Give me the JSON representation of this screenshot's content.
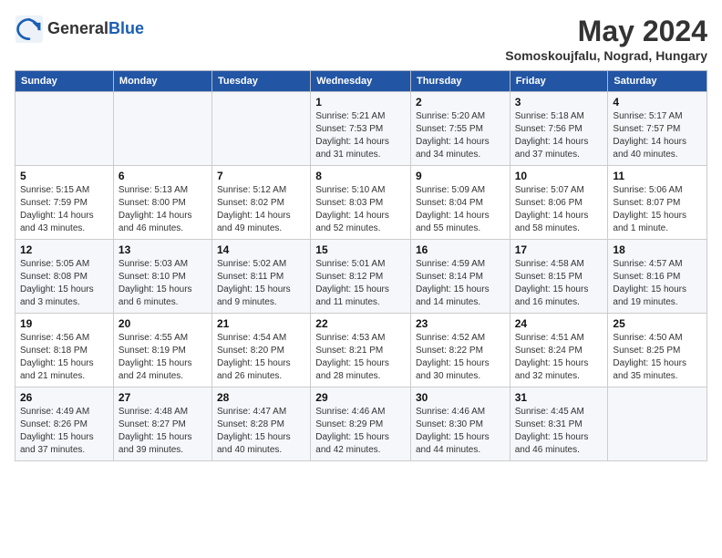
{
  "header": {
    "logo_general": "General",
    "logo_blue": "Blue",
    "month_title": "May 2024",
    "subtitle": "Somoskoujfalu, Nograd, Hungary"
  },
  "weekdays": [
    "Sunday",
    "Monday",
    "Tuesday",
    "Wednesday",
    "Thursday",
    "Friday",
    "Saturday"
  ],
  "rows": [
    [
      {
        "day": "",
        "sunrise": "",
        "sunset": "",
        "daylight": ""
      },
      {
        "day": "",
        "sunrise": "",
        "sunset": "",
        "daylight": ""
      },
      {
        "day": "",
        "sunrise": "",
        "sunset": "",
        "daylight": ""
      },
      {
        "day": "1",
        "sunrise": "Sunrise: 5:21 AM",
        "sunset": "Sunset: 7:53 PM",
        "daylight": "Daylight: 14 hours and 31 minutes."
      },
      {
        "day": "2",
        "sunrise": "Sunrise: 5:20 AM",
        "sunset": "Sunset: 7:55 PM",
        "daylight": "Daylight: 14 hours and 34 minutes."
      },
      {
        "day": "3",
        "sunrise": "Sunrise: 5:18 AM",
        "sunset": "Sunset: 7:56 PM",
        "daylight": "Daylight: 14 hours and 37 minutes."
      },
      {
        "day": "4",
        "sunrise": "Sunrise: 5:17 AM",
        "sunset": "Sunset: 7:57 PM",
        "daylight": "Daylight: 14 hours and 40 minutes."
      }
    ],
    [
      {
        "day": "5",
        "sunrise": "Sunrise: 5:15 AM",
        "sunset": "Sunset: 7:59 PM",
        "daylight": "Daylight: 14 hours and 43 minutes."
      },
      {
        "day": "6",
        "sunrise": "Sunrise: 5:13 AM",
        "sunset": "Sunset: 8:00 PM",
        "daylight": "Daylight: 14 hours and 46 minutes."
      },
      {
        "day": "7",
        "sunrise": "Sunrise: 5:12 AM",
        "sunset": "Sunset: 8:02 PM",
        "daylight": "Daylight: 14 hours and 49 minutes."
      },
      {
        "day": "8",
        "sunrise": "Sunrise: 5:10 AM",
        "sunset": "Sunset: 8:03 PM",
        "daylight": "Daylight: 14 hours and 52 minutes."
      },
      {
        "day": "9",
        "sunrise": "Sunrise: 5:09 AM",
        "sunset": "Sunset: 8:04 PM",
        "daylight": "Daylight: 14 hours and 55 minutes."
      },
      {
        "day": "10",
        "sunrise": "Sunrise: 5:07 AM",
        "sunset": "Sunset: 8:06 PM",
        "daylight": "Daylight: 14 hours and 58 minutes."
      },
      {
        "day": "11",
        "sunrise": "Sunrise: 5:06 AM",
        "sunset": "Sunset: 8:07 PM",
        "daylight": "Daylight: 15 hours and 1 minute."
      }
    ],
    [
      {
        "day": "12",
        "sunrise": "Sunrise: 5:05 AM",
        "sunset": "Sunset: 8:08 PM",
        "daylight": "Daylight: 15 hours and 3 minutes."
      },
      {
        "day": "13",
        "sunrise": "Sunrise: 5:03 AM",
        "sunset": "Sunset: 8:10 PM",
        "daylight": "Daylight: 15 hours and 6 minutes."
      },
      {
        "day": "14",
        "sunrise": "Sunrise: 5:02 AM",
        "sunset": "Sunset: 8:11 PM",
        "daylight": "Daylight: 15 hours and 9 minutes."
      },
      {
        "day": "15",
        "sunrise": "Sunrise: 5:01 AM",
        "sunset": "Sunset: 8:12 PM",
        "daylight": "Daylight: 15 hours and 11 minutes."
      },
      {
        "day": "16",
        "sunrise": "Sunrise: 4:59 AM",
        "sunset": "Sunset: 8:14 PM",
        "daylight": "Daylight: 15 hours and 14 minutes."
      },
      {
        "day": "17",
        "sunrise": "Sunrise: 4:58 AM",
        "sunset": "Sunset: 8:15 PM",
        "daylight": "Daylight: 15 hours and 16 minutes."
      },
      {
        "day": "18",
        "sunrise": "Sunrise: 4:57 AM",
        "sunset": "Sunset: 8:16 PM",
        "daylight": "Daylight: 15 hours and 19 minutes."
      }
    ],
    [
      {
        "day": "19",
        "sunrise": "Sunrise: 4:56 AM",
        "sunset": "Sunset: 8:18 PM",
        "daylight": "Daylight: 15 hours and 21 minutes."
      },
      {
        "day": "20",
        "sunrise": "Sunrise: 4:55 AM",
        "sunset": "Sunset: 8:19 PM",
        "daylight": "Daylight: 15 hours and 24 minutes."
      },
      {
        "day": "21",
        "sunrise": "Sunrise: 4:54 AM",
        "sunset": "Sunset: 8:20 PM",
        "daylight": "Daylight: 15 hours and 26 minutes."
      },
      {
        "day": "22",
        "sunrise": "Sunrise: 4:53 AM",
        "sunset": "Sunset: 8:21 PM",
        "daylight": "Daylight: 15 hours and 28 minutes."
      },
      {
        "day": "23",
        "sunrise": "Sunrise: 4:52 AM",
        "sunset": "Sunset: 8:22 PM",
        "daylight": "Daylight: 15 hours and 30 minutes."
      },
      {
        "day": "24",
        "sunrise": "Sunrise: 4:51 AM",
        "sunset": "Sunset: 8:24 PM",
        "daylight": "Daylight: 15 hours and 32 minutes."
      },
      {
        "day": "25",
        "sunrise": "Sunrise: 4:50 AM",
        "sunset": "Sunset: 8:25 PM",
        "daylight": "Daylight: 15 hours and 35 minutes."
      }
    ],
    [
      {
        "day": "26",
        "sunrise": "Sunrise: 4:49 AM",
        "sunset": "Sunset: 8:26 PM",
        "daylight": "Daylight: 15 hours and 37 minutes."
      },
      {
        "day": "27",
        "sunrise": "Sunrise: 4:48 AM",
        "sunset": "Sunset: 8:27 PM",
        "daylight": "Daylight: 15 hours and 39 minutes."
      },
      {
        "day": "28",
        "sunrise": "Sunrise: 4:47 AM",
        "sunset": "Sunset: 8:28 PM",
        "daylight": "Daylight: 15 hours and 40 minutes."
      },
      {
        "day": "29",
        "sunrise": "Sunrise: 4:46 AM",
        "sunset": "Sunset: 8:29 PM",
        "daylight": "Daylight: 15 hours and 42 minutes."
      },
      {
        "day": "30",
        "sunrise": "Sunrise: 4:46 AM",
        "sunset": "Sunset: 8:30 PM",
        "daylight": "Daylight: 15 hours and 44 minutes."
      },
      {
        "day": "31",
        "sunrise": "Sunrise: 4:45 AM",
        "sunset": "Sunset: 8:31 PM",
        "daylight": "Daylight: 15 hours and 46 minutes."
      },
      {
        "day": "",
        "sunrise": "",
        "sunset": "",
        "daylight": ""
      }
    ]
  ]
}
